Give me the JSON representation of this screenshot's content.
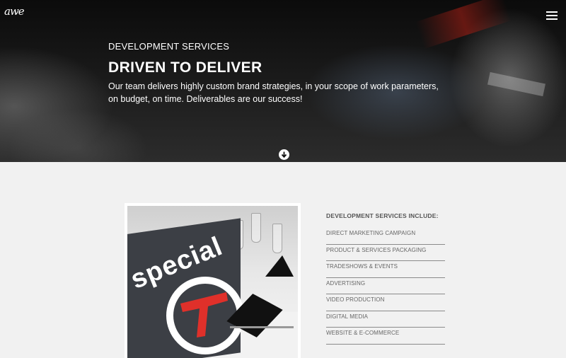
{
  "brand": {
    "logo_text": "awe",
    "logo_icon": "awe-logo-icon"
  },
  "nav": {
    "menu_icon": "hamburger-menu-icon"
  },
  "hero": {
    "eyebrow": "DEVELOPMENT SERVICES",
    "headline": "DRIVEN TO DELIVER",
    "description": "Our team delivers highly custom brand strategies, in your scope of work parameters, on budget, on time. Deliverables are our success!",
    "scroll_icon": "arrow-down-circle-icon"
  },
  "photo": {
    "card_word": "special"
  },
  "services": {
    "heading": "DEVELOPMENT SERVICES INCLUDE:",
    "items": [
      "DIRECT MARKETING CAMPAIGN",
      "PRODUCT & SERVICES PACKAGING",
      "TRADESHOWS & EVENTS",
      "ADVERTISING",
      "VIDEO PRODUCTION",
      "DIGITAL MEDIA",
      "WEBSITE & E-COMMERCE"
    ]
  },
  "colors": {
    "background": "#f1f1f1",
    "hero_text": "#ffffff",
    "accent_red": "#e0302a",
    "list_text": "#666666"
  }
}
